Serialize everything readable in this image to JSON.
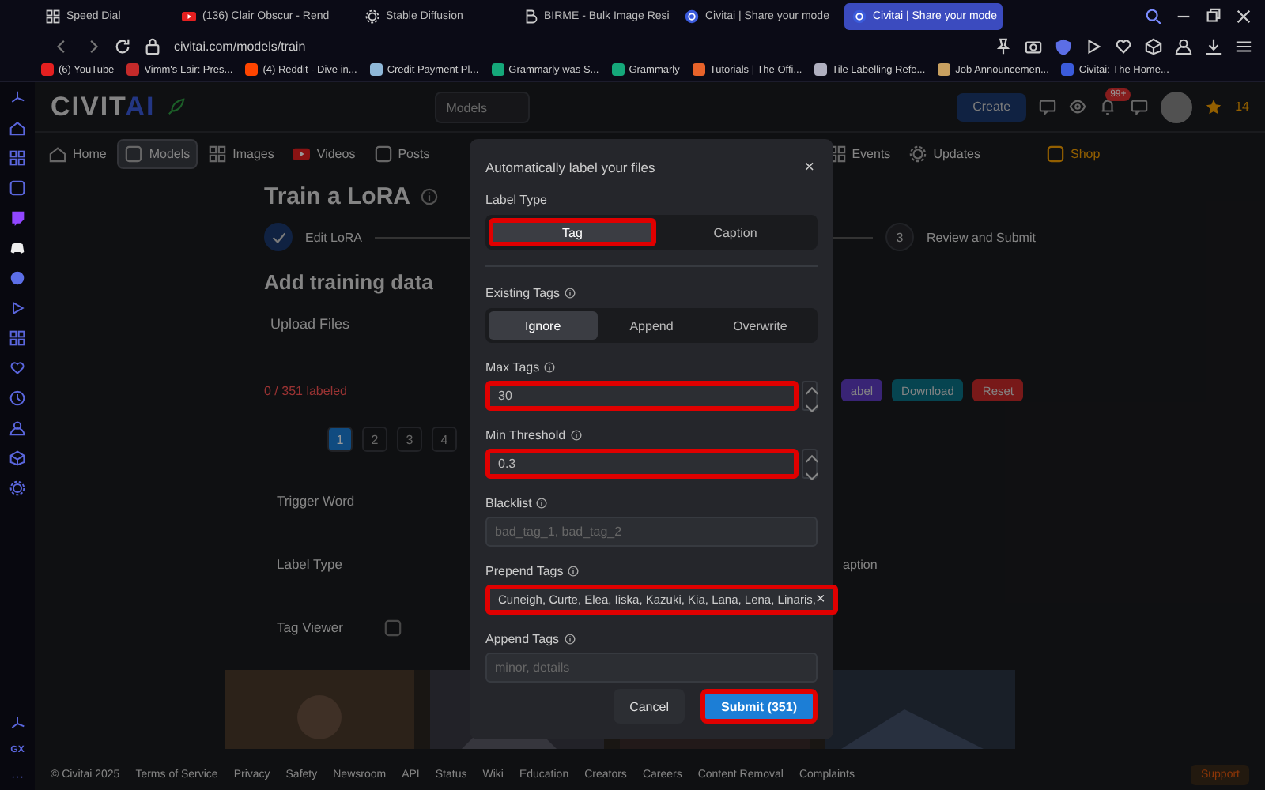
{
  "browser": {
    "tabs": [
      {
        "title": "Speed Dial",
        "selected": false
      },
      {
        "title": "(136) Clair Obscur - Rend",
        "selected": false
      },
      {
        "title": "Stable Diffusion",
        "selected": false
      },
      {
        "title": "BIRME - Bulk Image Resi",
        "selected": false
      },
      {
        "title": "Civitai | Share your mode",
        "selected": false
      },
      {
        "title": "Civitai | Share your mode",
        "selected": true
      }
    ],
    "address": "civitai.com/models/train",
    "bookmarks": [
      {
        "title": "(6) YouTube",
        "color": "#e52020"
      },
      {
        "title": "Vimm's Lair: Pres...",
        "color": "#c42a2a"
      },
      {
        "title": "(4) Reddit - Dive in...",
        "color": "#ff4500"
      },
      {
        "title": "Credit Payment Pl...",
        "color": "#8fb8d8"
      },
      {
        "title": "Grammarly was S...",
        "color": "#15a87a"
      },
      {
        "title": "Grammarly",
        "color": "#15a87a"
      },
      {
        "title": "Tutorials | The Offi...",
        "color": "#e8632a"
      },
      {
        "title": "Tile Labelling Refe...",
        "color": "#b0b0c0"
      },
      {
        "title": "Job Announcemen...",
        "color": "#c8a060"
      },
      {
        "title": "Civitai: The Home...",
        "color": "#3b5bdb"
      }
    ]
  },
  "opera_sidebar": {
    "label": "GX",
    "more": "···"
  },
  "site": {
    "logo_left": "CIVIT",
    "logo_right": "AI",
    "search_scope": "Models",
    "create": "Create",
    "notification_badge": "99+",
    "buzz": "14",
    "nav": [
      {
        "label": "Home",
        "selected": false
      },
      {
        "label": "Models",
        "selected": true
      },
      {
        "label": "Images",
        "selected": false
      },
      {
        "label": "Videos",
        "selected": false
      },
      {
        "label": "Posts",
        "selected": false
      },
      {
        "label": "Events",
        "selected": false
      },
      {
        "label": "Updates",
        "selected": false
      },
      {
        "label": "Shop",
        "selected": false
      }
    ]
  },
  "page": {
    "title": "Train a LoRA",
    "steps": [
      {
        "label": "Edit LoRA",
        "done": true
      },
      {
        "number": "3",
        "label": "Review and Submit",
        "done": false
      }
    ],
    "section": "Add training data",
    "upload": "Upload Files",
    "labeled": "0 / 351 labeled",
    "actions": [
      {
        "label": "abel",
        "kind": "label"
      },
      {
        "label": "Download",
        "kind": "download"
      },
      {
        "label": "Reset",
        "kind": "reset"
      }
    ],
    "pages": [
      {
        "label": "1",
        "selected": true
      },
      {
        "label": "2",
        "selected": false
      },
      {
        "label": "3",
        "selected": false
      },
      {
        "label": "4",
        "selected": false
      }
    ],
    "trigger_word": "Trigger Word",
    "label_type": "Label Type",
    "label_type_value": "aption",
    "tag_viewer": "Tag Viewer"
  },
  "footer": {
    "links": [
      "© Civitai 2025",
      "Terms of Service",
      "Privacy",
      "Safety",
      "Newsroom",
      "API",
      "Status",
      "Wiki",
      "Education",
      "Creators",
      "Careers",
      "Content Removal",
      "Complaints"
    ],
    "support": "Support"
  },
  "modal": {
    "title": "Automatically label your files",
    "close": "×",
    "label_type": {
      "label": "Label Type",
      "options": [
        {
          "label": "Tag",
          "selected": true,
          "highlighted": true
        },
        {
          "label": "Caption",
          "selected": false,
          "highlighted": false
        }
      ]
    },
    "existing_tags": {
      "label": "Existing Tags",
      "options": [
        {
          "label": "Ignore",
          "selected": true
        },
        {
          "label": "Append",
          "selected": false
        },
        {
          "label": "Overwrite",
          "selected": false
        }
      ]
    },
    "fields": [
      {
        "label": "Max Tags",
        "kind": "number",
        "value": "30",
        "highlighted": true
      },
      {
        "label": "Min Threshold",
        "kind": "number",
        "value": "0.3",
        "highlighted": true
      },
      {
        "label": "Blacklist",
        "kind": "text",
        "placeholder": "bad_tag_1, bad_tag_2",
        "highlighted": false
      },
      {
        "label": "Prepend Tags",
        "kind": "tags",
        "value": "Cuneigh, Curte, Elea, Iiska, Kazuki, Kia, Lana, Lena, Linaris,",
        "clear": "×",
        "highlighted": true
      },
      {
        "label": "Append Tags",
        "kind": "text",
        "placeholder": "minor, details",
        "highlighted": false
      }
    ],
    "buttons": [
      {
        "label": "Cancel",
        "kind": "secondary",
        "highlighted": false
      },
      {
        "label": "Submit (351)",
        "kind": "primary",
        "highlighted": true
      }
    ]
  }
}
